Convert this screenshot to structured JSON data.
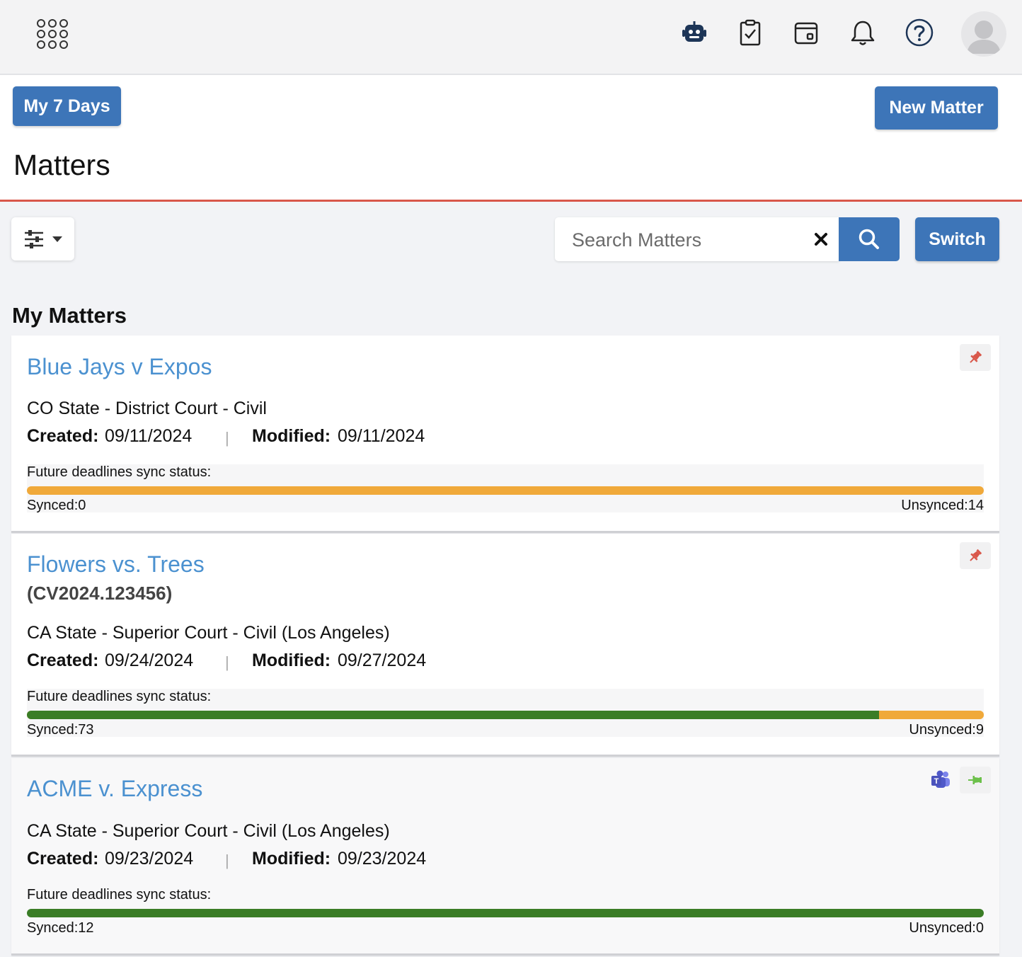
{
  "topbar": {
    "icons": [
      "apps-grid-icon",
      "robot-icon",
      "clipboard-check-icon",
      "calendar-icon",
      "bell-icon",
      "help-icon",
      "avatar"
    ]
  },
  "header": {
    "my7days_label": "My 7 Days",
    "new_matter_label": "New Matter",
    "page_title": "Matters"
  },
  "toolbar": {
    "search_placeholder": "Search Matters",
    "switch_label": "Switch"
  },
  "section_title": "My Matters",
  "colors": {
    "accent": "#3d75b8",
    "link": "#4b91d0",
    "divider": "#d9574a",
    "synced": "#3a7d26",
    "unsynced": "#f0a93a",
    "pinned": "#d9574a",
    "unpinned": "#6cc04a"
  },
  "matters": [
    {
      "title": "Blue Jays v Expos",
      "case_number": "",
      "court": "CO State - District Court - Civil",
      "created_label": "Created:",
      "created": "09/11/2024",
      "modified_label": "Modified:",
      "modified": "09/11/2024",
      "sync_label": "Future deadlines sync status:",
      "synced": 0,
      "unsynced": 14,
      "synced_text": "Synced:0",
      "unsynced_text": "Unsynced:14",
      "pinned": true
    },
    {
      "title": "Flowers vs. Trees",
      "case_number": "(CV2024.123456)",
      "court": "CA State - Superior Court - Civil (Los Angeles)",
      "created_label": "Created:",
      "created": "09/24/2024",
      "modified_label": "Modified:",
      "modified": "09/27/2024",
      "sync_label": "Future deadlines sync status:",
      "synced": 73,
      "unsynced": 9,
      "synced_text": "Synced:73",
      "unsynced_text": "Unsynced:9",
      "pinned": true
    },
    {
      "title": "ACME v. Express",
      "case_number": "",
      "court": "CA State - Superior Court - Civil (Los Angeles)",
      "created_label": "Created:",
      "created": "09/23/2024",
      "modified_label": "Modified:",
      "modified": "09/23/2024",
      "sync_label": "Future deadlines sync status:",
      "synced": 12,
      "unsynced": 0,
      "synced_text": "Synced:12",
      "unsynced_text": "Unsynced:0",
      "pinned": false,
      "teams_linked": true
    }
  ]
}
